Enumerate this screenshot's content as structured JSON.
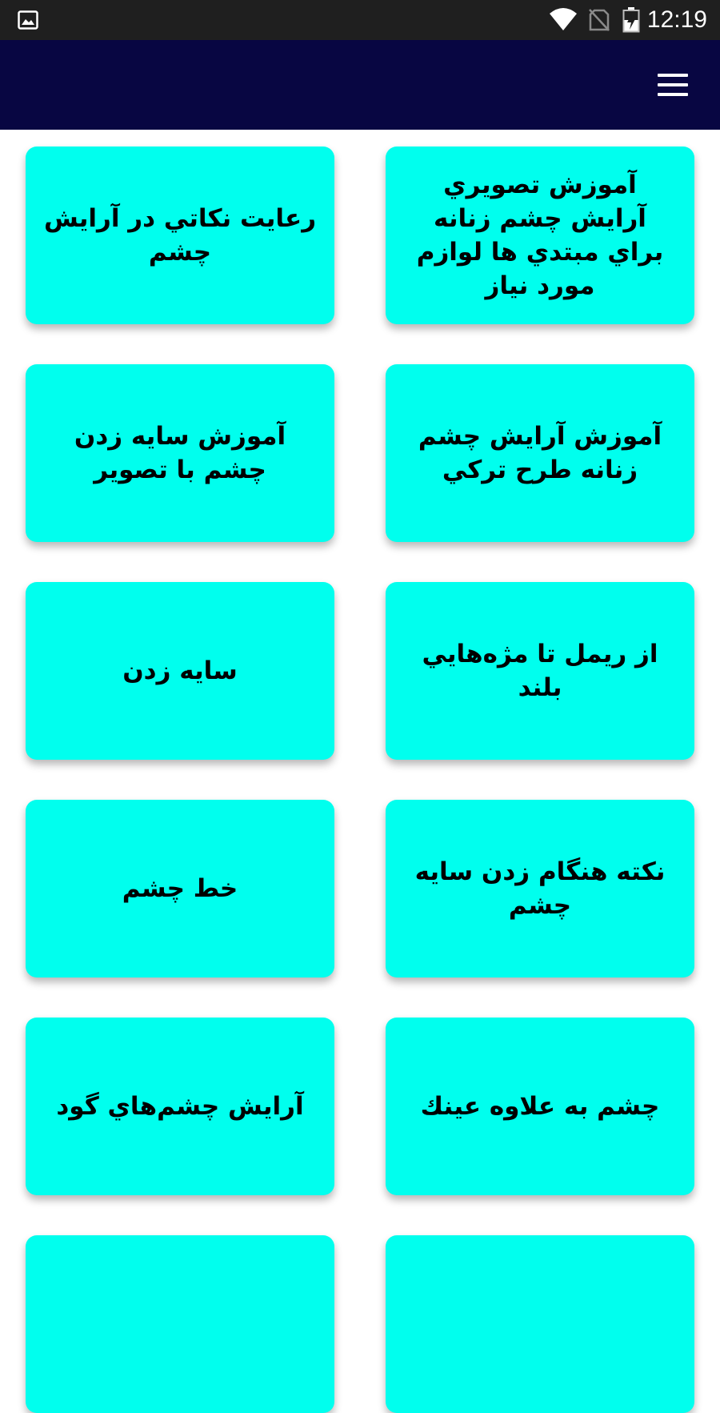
{
  "status_bar": {
    "time": "12:19",
    "icons": [
      "gallery-icon",
      "wifi-icon",
      "no-sim-icon",
      "battery-icon"
    ]
  },
  "app_bar": {
    "background_color": "#080642",
    "menu_icon": "hamburger-menu-icon"
  },
  "cards": [
    {
      "title": "آموزش تصويري آرايش چشم زنانه براي مبتدي ها لوازم مورد نياز"
    },
    {
      "title": "رعايت نكاتي در آرايش چشم"
    },
    {
      "title": "آموزش آرايش چشم زنانه طرح تركي"
    },
    {
      "title": "آموزش سايه زدن چشم با تصوير"
    },
    {
      "title": "از ريمل تا مژه‌هايي بلند"
    },
    {
      "title": "سايه زدن"
    },
    {
      "title": "نكته هنگام زدن سايه چشم"
    },
    {
      "title": "خط چشم"
    },
    {
      "title": "چشم به علاوه عينك"
    },
    {
      "title": "آرايش چشم‌هاي گود"
    },
    {
      "title": ""
    },
    {
      "title": ""
    }
  ],
  "colors": {
    "card": "#00ffee",
    "status_bar": "#1f1f1f"
  }
}
